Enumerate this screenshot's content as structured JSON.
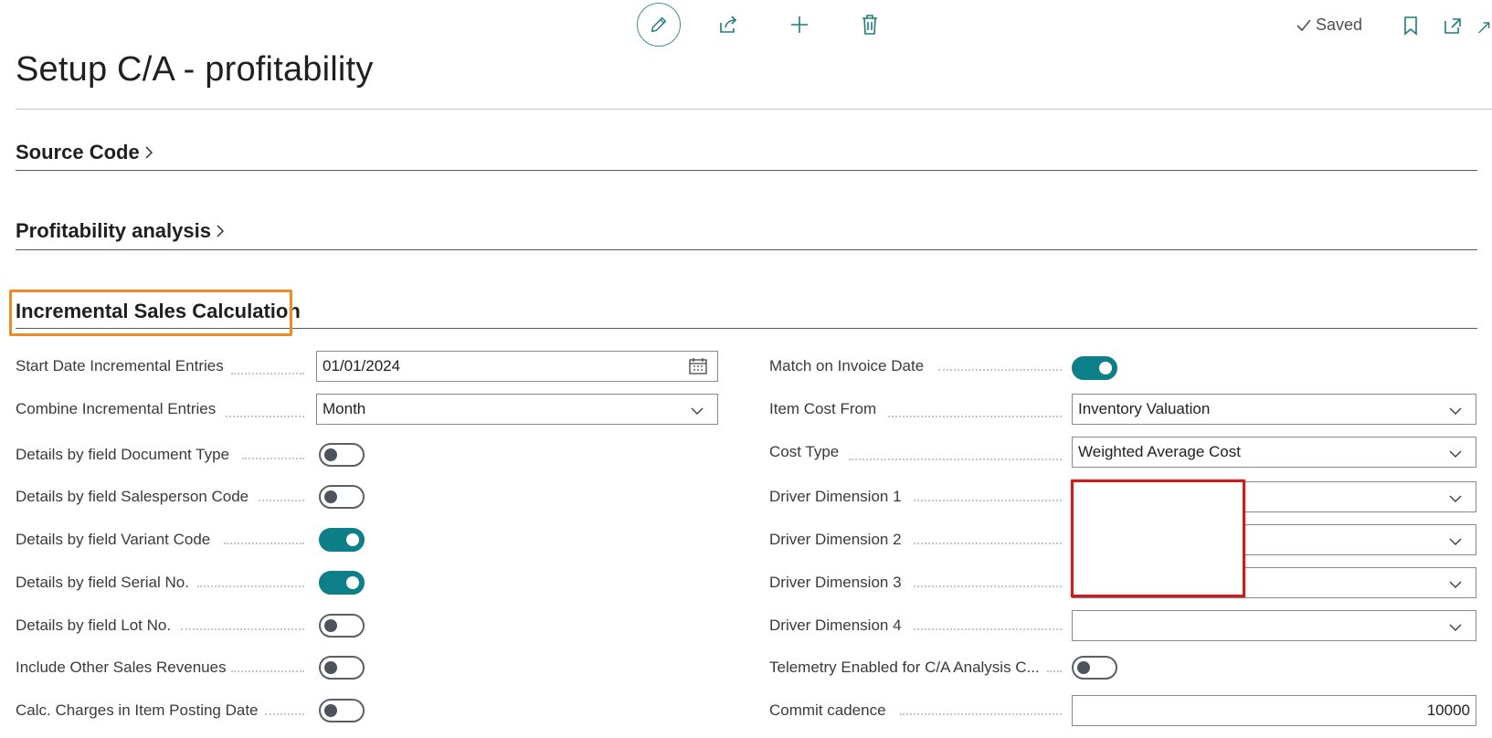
{
  "toolbar": {
    "edit_icon": "pencil-icon",
    "share_icon": "share-icon",
    "new_icon": "plus-icon",
    "delete_icon": "trash-icon",
    "saved_label": "Saved",
    "bookmark_icon": "bookmark-icon",
    "open_new_window_icon": "open-new-window-icon",
    "expand_icon": "expand-icon"
  },
  "page": {
    "title": "Setup C/A - profitability"
  },
  "sections": {
    "source_code": "Source Code",
    "profitability_analysis": "Profitability analysis",
    "incremental_sales": "Incremental Sales Calculation"
  },
  "left_fields": [
    {
      "label": "Start Date Incremental Entries",
      "type": "date",
      "value": "01/01/2024"
    },
    {
      "label": "Combine Incremental Entries",
      "type": "select",
      "value": "Month"
    },
    {
      "label": "Details by field Document Type",
      "type": "toggle",
      "on": false
    },
    {
      "label": "Details by field Salesperson Code",
      "type": "toggle",
      "on": false
    },
    {
      "label": "Details by field Variant Code",
      "type": "toggle",
      "on": true
    },
    {
      "label": "Details by field Serial No.",
      "type": "toggle",
      "on": true
    },
    {
      "label": "Details by field Lot No.",
      "type": "toggle",
      "on": false
    },
    {
      "label": "Include Other Sales Revenues",
      "type": "toggle",
      "on": false
    },
    {
      "label": "Calc. Charges in Item Posting Date",
      "type": "toggle",
      "on": false
    }
  ],
  "right_fields": [
    {
      "label": "Match on Invoice Date",
      "type": "toggle",
      "on": true
    },
    {
      "label": "Item Cost From",
      "type": "select",
      "value": "Inventory Valuation"
    },
    {
      "label": "Cost Type",
      "type": "select",
      "value": "Weighted Average Cost"
    },
    {
      "label": "Driver Dimension 1",
      "type": "select",
      "value": ""
    },
    {
      "label": "Driver Dimension 2",
      "type": "select",
      "value": ""
    },
    {
      "label": "Driver Dimension 3",
      "type": "select",
      "value": ""
    },
    {
      "label": "Driver Dimension 4",
      "type": "select",
      "value": ""
    },
    {
      "label": "Telemetry Enabled for C/A Analysis C...",
      "type": "toggle",
      "on": false
    },
    {
      "label": "Commit cadence",
      "type": "number",
      "value": "10000"
    }
  ],
  "colors": {
    "accent": "#0d7f88",
    "highlight_orange": "#f08a24",
    "highlight_red": "#d11a1a"
  }
}
